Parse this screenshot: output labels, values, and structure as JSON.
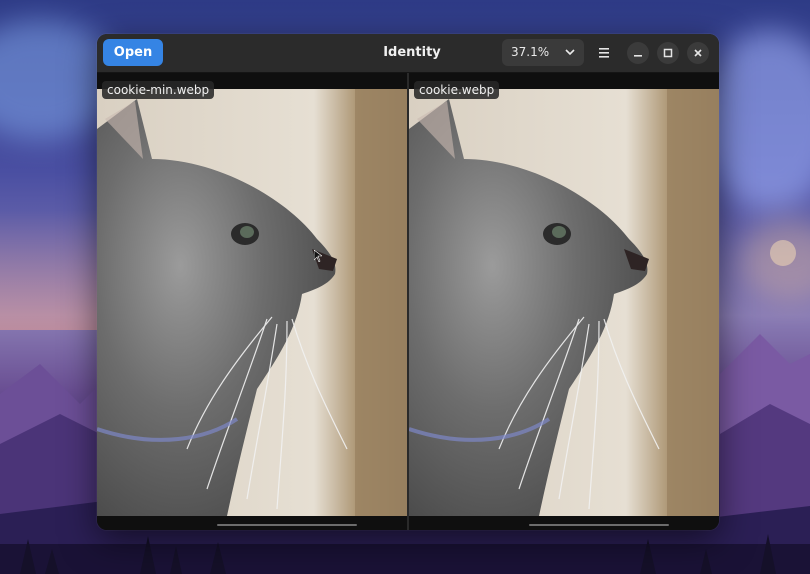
{
  "window": {
    "title": "Identity",
    "open_label": "Open",
    "zoom": "37.1%"
  },
  "panes": [
    {
      "filename": "cookie-min.webp"
    },
    {
      "filename": "cookie.webp"
    }
  ],
  "icons": {
    "zoom_dropdown": "chevron-down-icon",
    "menu": "hamburger-menu-icon",
    "minimize": "minimize-icon",
    "maximize": "maximize-icon",
    "close": "close-icon"
  },
  "colors": {
    "accent": "#3584e4",
    "headerbar": "#2b2b2b"
  }
}
